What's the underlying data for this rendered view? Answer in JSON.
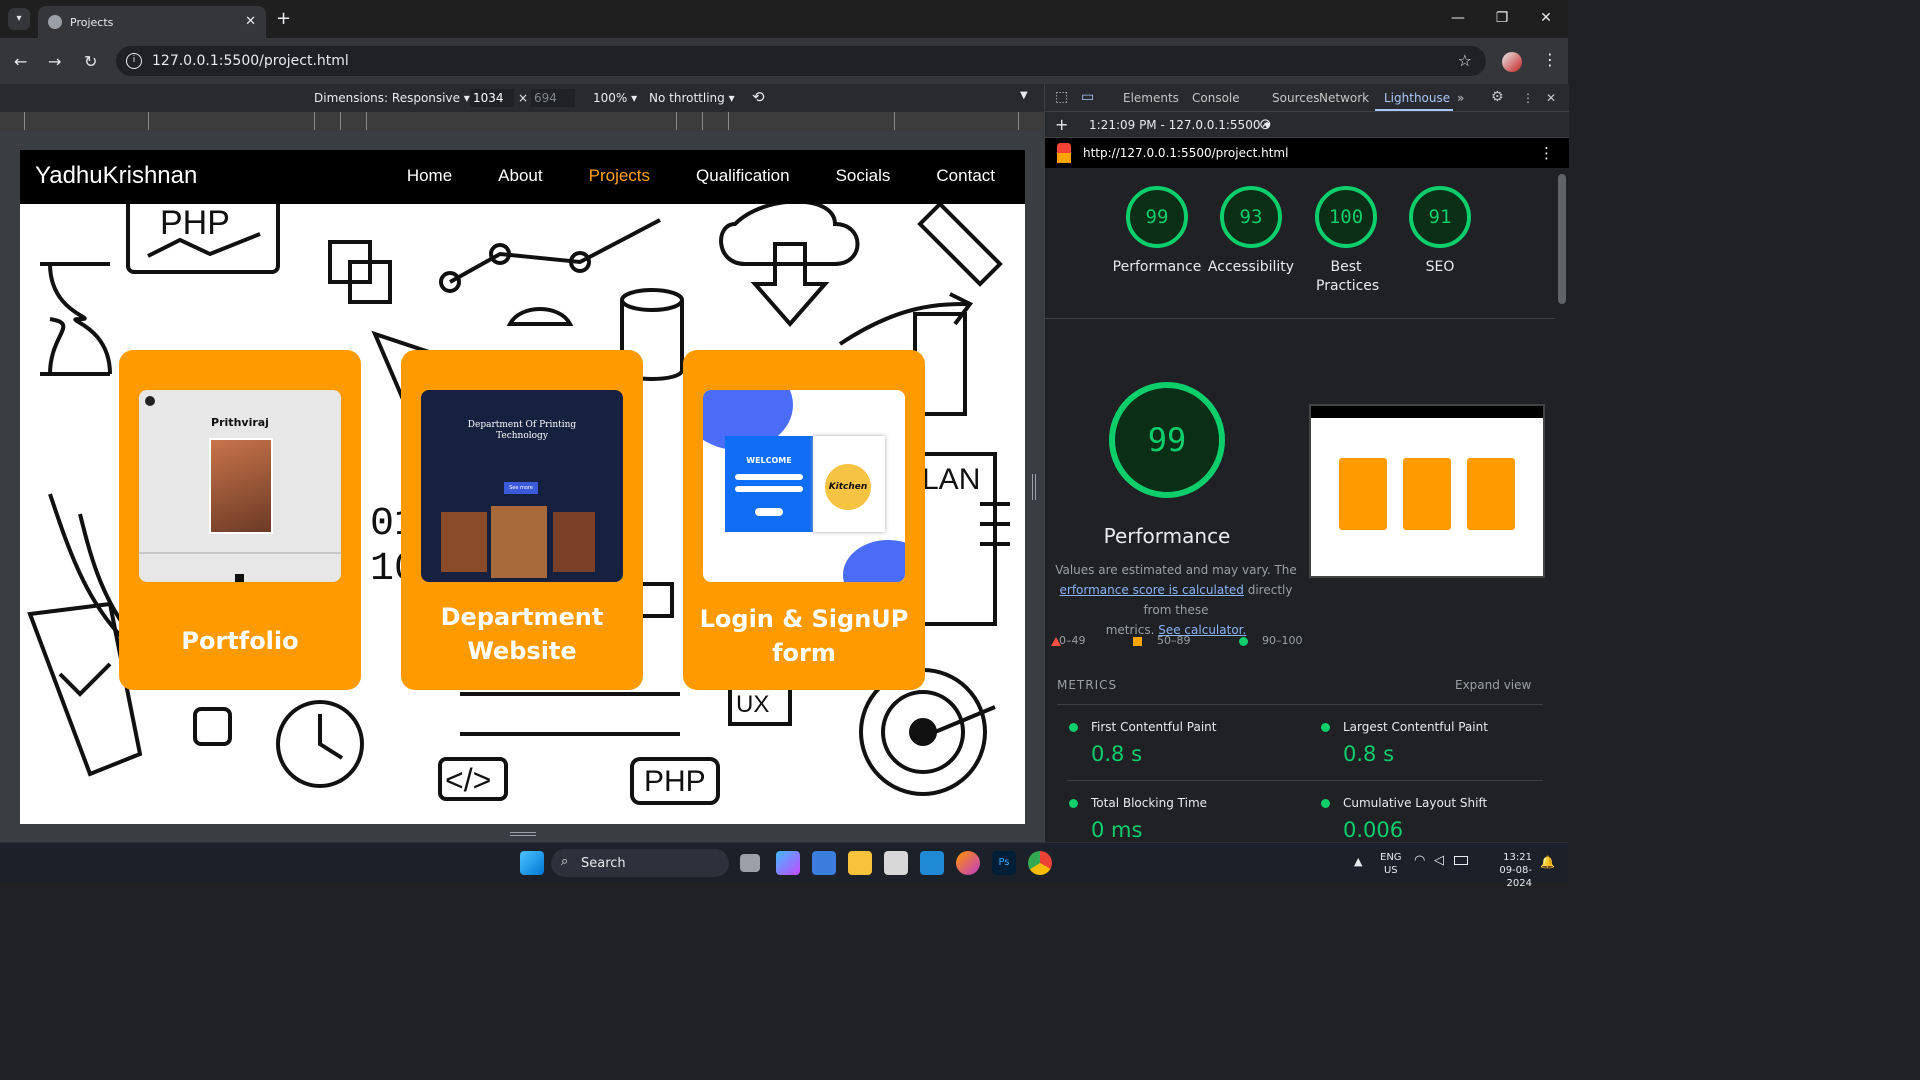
{
  "browser": {
    "tab_title": "Projects",
    "url": "127.0.0.1:5500/project.html",
    "new_tab": "+"
  },
  "device_toolbar": {
    "dimensions": "Dimensions: Responsive",
    "width": "1034",
    "height": "694",
    "zoom": "100%",
    "throttling": "No throttling"
  },
  "site": {
    "brand": "YadhuKrishnan",
    "nav": [
      "Home",
      "About",
      "Projects",
      "Qualification",
      "Socials",
      "Contact"
    ],
    "active_nav": "Projects",
    "cards": [
      {
        "title_line1": "Portfolio",
        "title_line2": "",
        "thumb_heading": "Prithviraj"
      },
      {
        "title_line1": "Department",
        "title_line2": "Website",
        "thumb_heading": "Department Of Printing Technology",
        "thumb_button": "See more"
      },
      {
        "title_line1": "Login & SignUP",
        "title_line2": "form",
        "thumb_heading": "WELCOME",
        "thumb_logo": "Kitchen"
      }
    ],
    "doodle_labels": [
      "PHP",
      "LAN",
      "UX",
      "PHP",
      "</>",
      "01",
      "10"
    ]
  },
  "devtools": {
    "tabs": [
      "Elements",
      "Console",
      "Sources",
      "Network",
      "Lighthouse"
    ],
    "active_tab": "Lighthouse",
    "report_selector": "1:21:09 PM - 127.0.0.1:5500",
    "report_url": "http://127.0.0.1:5500/project.html",
    "scores": [
      {
        "value": "99",
        "label": "Performance"
      },
      {
        "value": "93",
        "label": "Accessibility"
      },
      {
        "value": "100",
        "label": "Best Practices"
      },
      {
        "value": "91",
        "label": "SEO"
      }
    ],
    "perf_score": "99",
    "perf_title": "Performance",
    "perf_note_1": "Values are estimated and may vary. The",
    "perf_note_link": "erformance score is calculated",
    "perf_note_2": "directly from these",
    "perf_note_3": "metrics.",
    "perf_note_link2": "See calculator.",
    "legend": [
      "0–49",
      "50–89",
      "90–100"
    ],
    "metrics_header": "METRICS",
    "expand_view": "Expand view",
    "metrics": [
      {
        "name": "First Contentful Paint",
        "value": "0.8 s"
      },
      {
        "name": "Largest Contentful Paint",
        "value": "0.8 s"
      },
      {
        "name": "Total Blocking Time",
        "value": "0 ms"
      },
      {
        "name": "Cumulative Layout Shift",
        "value": "0.006"
      }
    ],
    "colors": {
      "pass": "#0cce6b",
      "average": "#ffa400",
      "fail": "#ff4e42"
    }
  },
  "taskbar": {
    "search": "Search",
    "lang_line1": "ENG",
    "lang_line2": "US",
    "time": "13:21",
    "date": "09-08-2024"
  }
}
